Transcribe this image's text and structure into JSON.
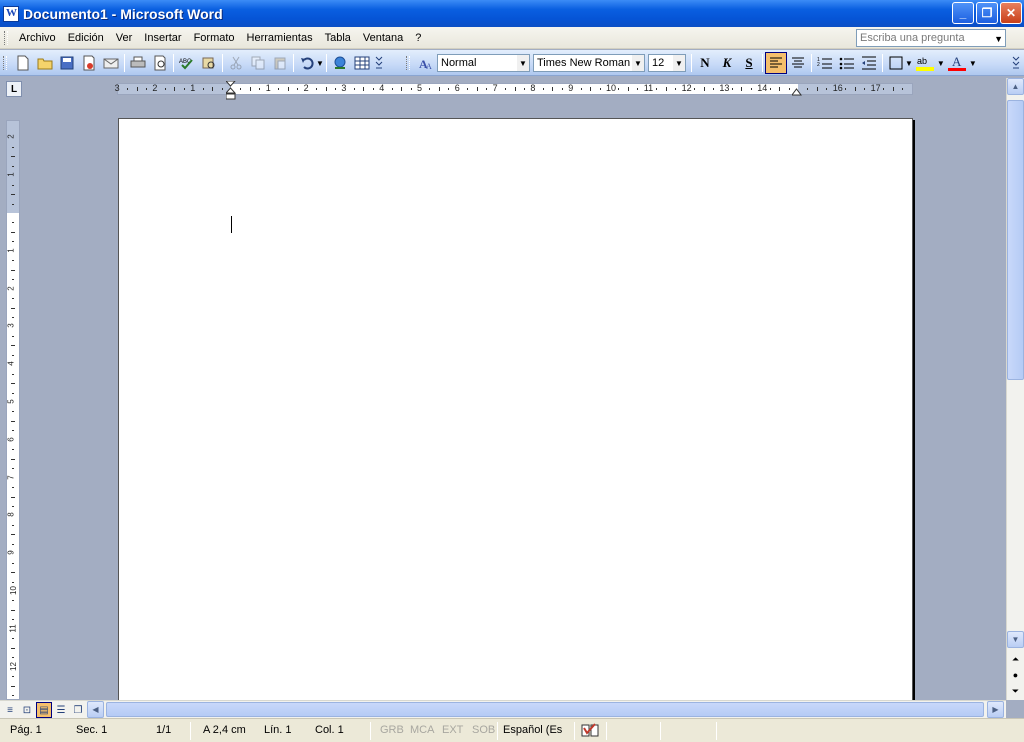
{
  "window": {
    "title": "Documento1 - Microsoft Word",
    "buttons": {
      "minimize": "_",
      "maximize": "❐",
      "close": "✕"
    }
  },
  "menu": {
    "items": [
      {
        "label": "Archivo"
      },
      {
        "label": "Edición"
      },
      {
        "label": "Ver"
      },
      {
        "label": "Insertar"
      },
      {
        "label": "Formato"
      },
      {
        "label": "Herramientas"
      },
      {
        "label": "Tabla"
      },
      {
        "label": "Ventana"
      },
      {
        "label": "?"
      }
    ],
    "help_placeholder": "Escriba una pregunta"
  },
  "toolbar": {
    "style_value": "Normal",
    "font_value": "Times New Roman",
    "size_value": "12",
    "bold_label": "N",
    "italic_label": "K",
    "underline_label": "S",
    "highlight_label": "ab",
    "font_color_label": "A",
    "highlight_color": "#ffff00",
    "font_color": "#ff0000"
  },
  "ruler": {
    "h_numbers": [
      "3",
      "2",
      "1",
      "1",
      "2",
      "3",
      "4",
      "5",
      "6",
      "7",
      "8",
      "9",
      "10",
      "11",
      "12",
      "13",
      "14",
      "16",
      "17"
    ],
    "v_numbers": [
      "2",
      "1",
      "1",
      "2",
      "3",
      "4",
      "5",
      "6",
      "7",
      "8",
      "9",
      "10",
      "11",
      "12"
    ]
  },
  "statusbar": {
    "page": "Pág. 1",
    "section": "Sec. 1",
    "page_of": "1/1",
    "at": "A  2,4 cm",
    "line": "Lín. 1",
    "col": "Col. 1",
    "grb": "GRB",
    "mca": "MCA",
    "ext": "EXT",
    "sob": "SOB",
    "language": "Español (Es"
  }
}
